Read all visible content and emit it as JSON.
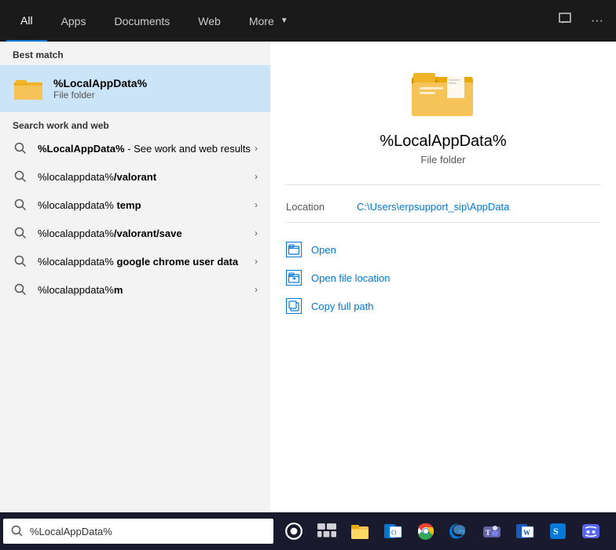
{
  "nav": {
    "tabs": [
      {
        "label": "All",
        "active": true
      },
      {
        "label": "Apps",
        "active": false
      },
      {
        "label": "Documents",
        "active": false
      },
      {
        "label": "Web",
        "active": false
      },
      {
        "label": "More",
        "active": false,
        "has_arrow": true
      }
    ],
    "icon_chat": "💬",
    "icon_more": "···"
  },
  "best_match": {
    "section_label": "Best match",
    "title": "%LocalAppData%",
    "subtitle": "File folder"
  },
  "search_web": {
    "section_label": "Search work and web",
    "items": [
      {
        "text_plain": "%LocalAppData%",
        "text_suffix": " - See work and web results",
        "bold": true
      },
      {
        "text_plain": "%localappdata%",
        "text_bold": "/valorant",
        "bold_part": "suffix"
      },
      {
        "text_plain": "%localappdata% ",
        "text_bold": "temp",
        "bold_part": "suffix"
      },
      {
        "text_plain": "%localappdata%",
        "text_bold": "/valorant/save",
        "bold_part": "suffix"
      },
      {
        "text_plain": "%localappdata% ",
        "text_bold": "google chrome user data",
        "bold_part": "suffix"
      },
      {
        "text_plain": "%localappdata%",
        "text_bold": "m",
        "bold_part": "suffix"
      }
    ]
  },
  "right_panel": {
    "title": "%LocalAppData%",
    "subtitle": "File folder",
    "location_label": "Location",
    "location_value": "C:\\Users\\erpsupport_sip\\AppData",
    "actions": [
      {
        "label": "Open"
      },
      {
        "label": "Open file location"
      },
      {
        "label": "Copy full path"
      }
    ]
  },
  "taskbar": {
    "search_value": "%LocalAppData%",
    "icons": [
      "search",
      "task-view",
      "file-explorer",
      "outlook",
      "chrome",
      "edge",
      "teams",
      "word",
      "unknown",
      "discord"
    ]
  }
}
